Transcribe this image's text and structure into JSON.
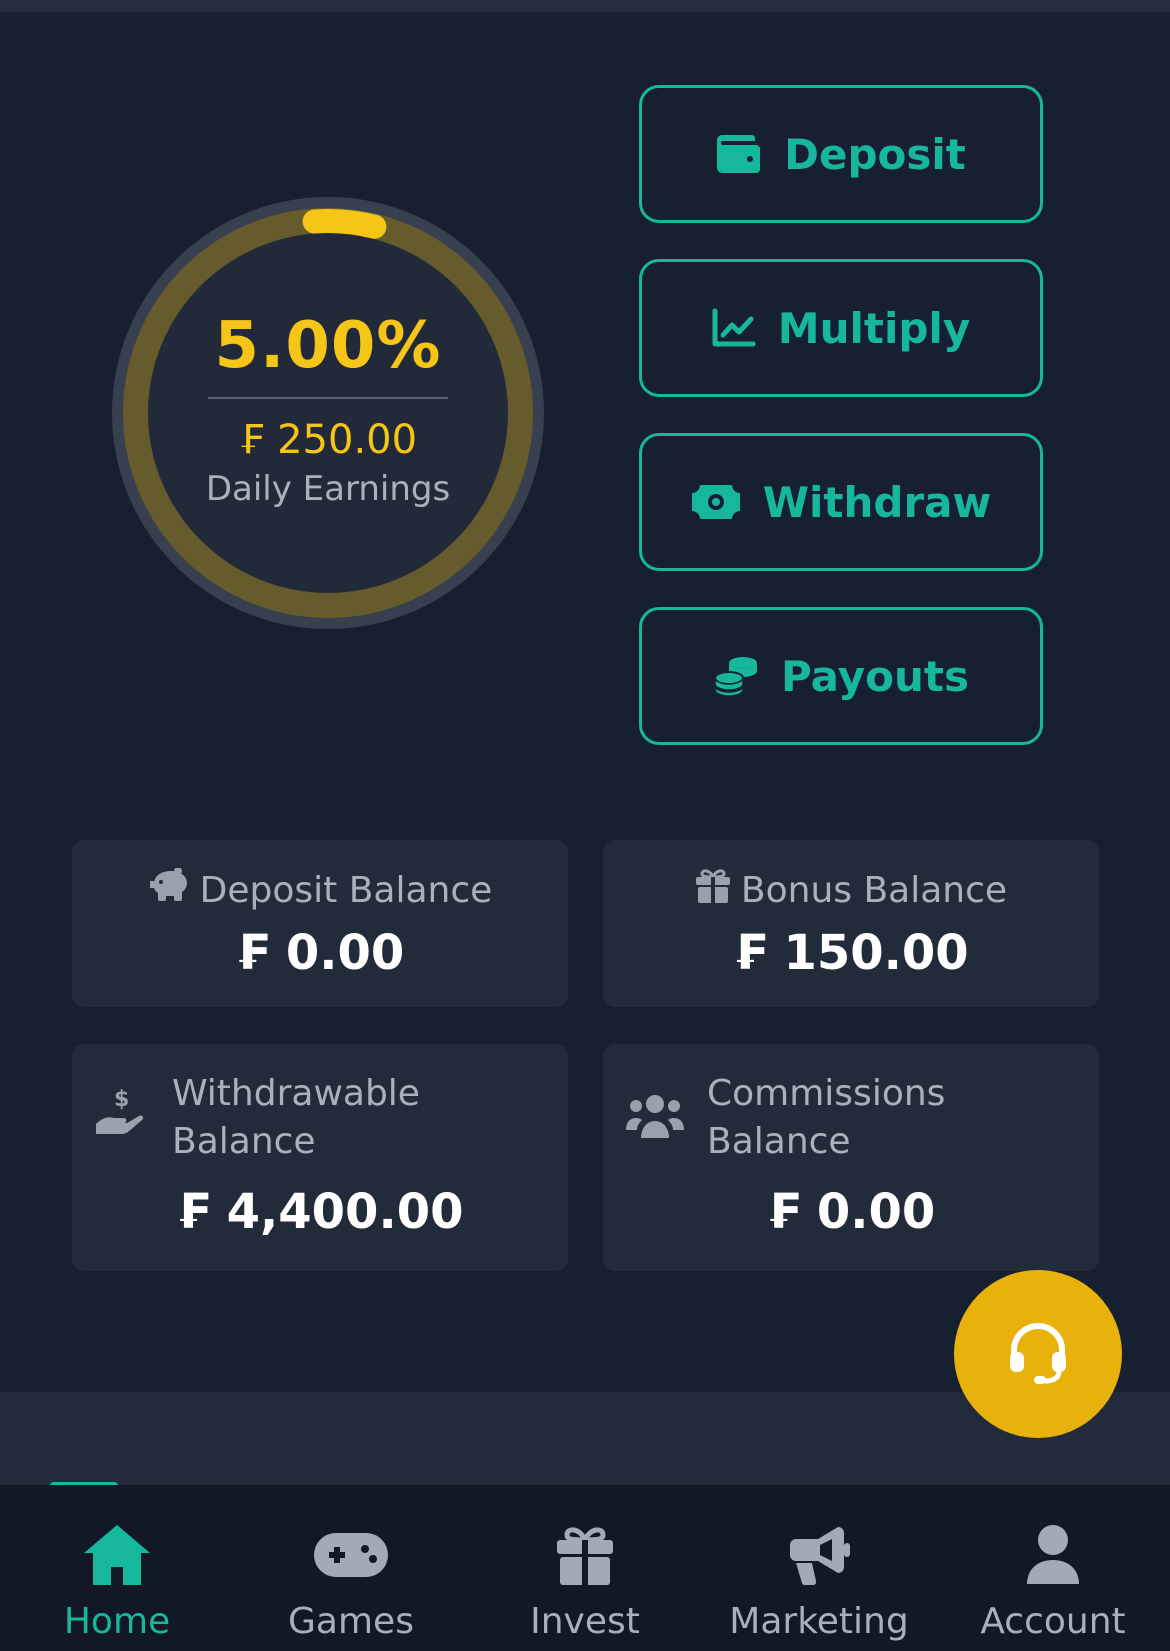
{
  "colors": {
    "background": "#172030",
    "accent_teal": "#17b79c",
    "accent_yellow": "#f5c518",
    "card_background": "#222b3a",
    "fab_background": "#e8b10b",
    "nav_background": "#121826"
  },
  "earnings": {
    "percent": "5.00%",
    "progress_fraction": 0.05,
    "amount": "₣ 250.00",
    "label": "Daily Earnings"
  },
  "actions": [
    {
      "label": "Deposit",
      "icon": "wallet-icon"
    },
    {
      "label": "Multiply",
      "icon": "chart-line-icon"
    },
    {
      "label": "Withdraw",
      "icon": "money-bill-icon"
    },
    {
      "label": "Payouts",
      "icon": "coins-icon"
    }
  ],
  "balances": {
    "deposit": {
      "label": "Deposit Balance",
      "value": "₣ 0.00",
      "icon": "piggy-bank-icon"
    },
    "bonus": {
      "label": "Bonus Balance",
      "value": "₣ 150.00",
      "icon": "gift-icon"
    },
    "withdrawable": {
      "label": "Withdrawable Balance",
      "value": "₣ 4,400.00",
      "icon": "hand-dollar-icon"
    },
    "commissions": {
      "label": "Commissions Balance",
      "value": "₣ 0.00",
      "icon": "users-icon"
    }
  },
  "support": {
    "icon": "headset-icon"
  },
  "nav": [
    {
      "label": "Home",
      "icon": "home-icon",
      "active": true
    },
    {
      "label": "Games",
      "icon": "gamepad-icon",
      "active": false
    },
    {
      "label": "Invest",
      "icon": "gift-icon",
      "active": false
    },
    {
      "label": "Marketing",
      "icon": "megaphone-icon",
      "active": false
    },
    {
      "label": "Account",
      "icon": "user-icon",
      "active": false
    }
  ]
}
